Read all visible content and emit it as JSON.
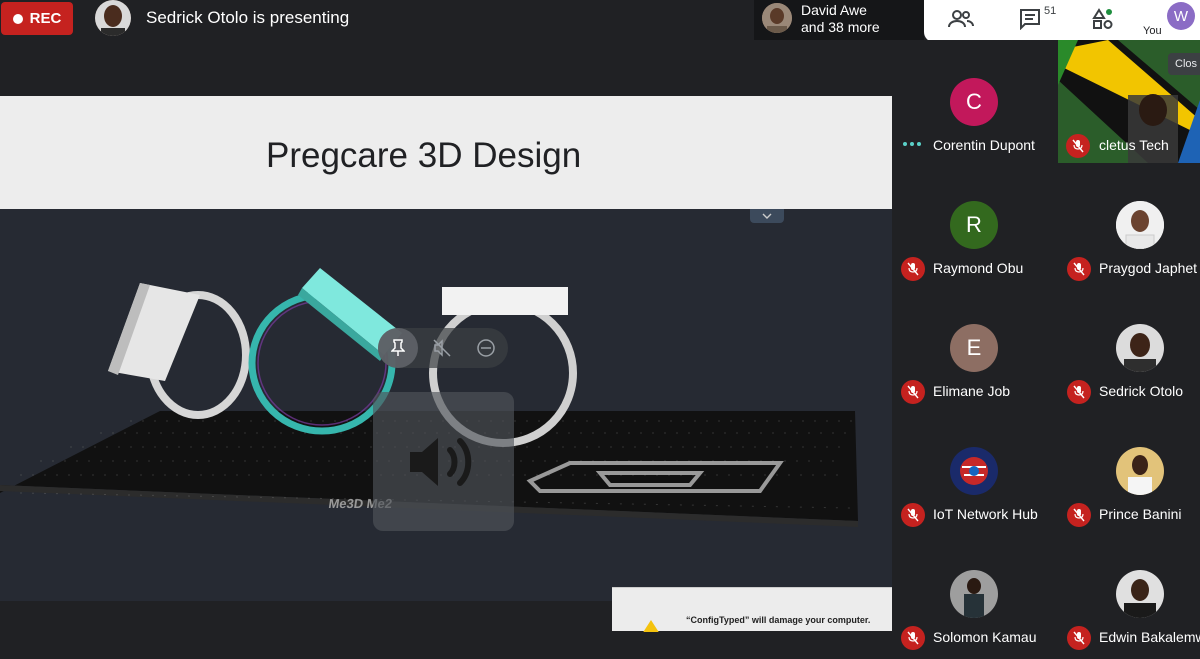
{
  "topbar": {
    "rec_label": "REC",
    "presenting_text": "Sedrick Otolo is presenting",
    "people_name": "David Awe",
    "people_more": "and 38 more",
    "participant_count": "51",
    "you_initial": "W",
    "you_label": "You"
  },
  "slide": {
    "title": "Pregcare 3D Design"
  },
  "dialog": {
    "warning_text": "“ConfigTyped” will damage your computer."
  },
  "participants": [
    {
      "name": "Corentin Dupont",
      "initial": "C",
      "color": "#c2185b",
      "status": "speaking"
    },
    {
      "name": "cletus Tech",
      "status": "muted"
    },
    {
      "name": "Raymond Obu",
      "initial": "R",
      "color": "#33691e",
      "status": "muted"
    },
    {
      "name": "Praygod Japhet",
      "status": "muted"
    },
    {
      "name": "Elimane Job",
      "initial": "E",
      "color": "#8d6e63",
      "status": "muted"
    },
    {
      "name": "Sedrick Otolo",
      "status": "muted"
    },
    {
      "name": "IoT Network Hub",
      "status": "muted"
    },
    {
      "name": "Prince Banini",
      "status": "muted"
    },
    {
      "name": "Solomon Kamau",
      "status": "muted"
    },
    {
      "name": "Edwin Bakalemwa",
      "status": "muted"
    }
  ],
  "video_tile": {
    "close_label": "Clos"
  },
  "colors": {
    "rec": "#c5221f",
    "accent_teal": "#5ad0c8",
    "you_avatar": "#8b6cc5"
  }
}
